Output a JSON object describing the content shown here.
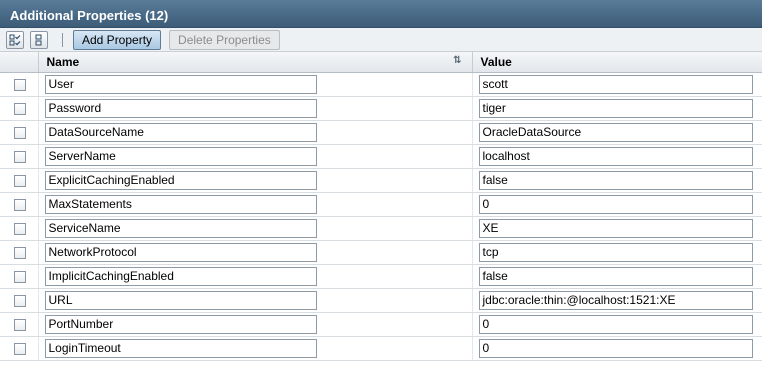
{
  "panel": {
    "title": "Additional Properties (12)"
  },
  "toolbar": {
    "select_all_icon": "select-all-icon",
    "select_none_icon": "select-none-icon",
    "add_label": "Add Property",
    "delete_label": "Delete Properties"
  },
  "table": {
    "headers": {
      "name": "Name",
      "value": "Value"
    },
    "rows": [
      {
        "name": "User",
        "value": "scott"
      },
      {
        "name": "Password",
        "value": "tiger"
      },
      {
        "name": "DataSourceName",
        "value": "OracleDataSource"
      },
      {
        "name": "ServerName",
        "value": "localhost"
      },
      {
        "name": "ExplicitCachingEnabled",
        "value": "false"
      },
      {
        "name": "MaxStatements",
        "value": "0"
      },
      {
        "name": "ServiceName",
        "value": "XE"
      },
      {
        "name": "NetworkProtocol",
        "value": "tcp"
      },
      {
        "name": "ImplicitCachingEnabled",
        "value": "false"
      },
      {
        "name": "URL",
        "value": "jdbc:oracle:thin:@localhost:1521:XE"
      },
      {
        "name": "PortNumber",
        "value": "0"
      },
      {
        "name": "LoginTimeout",
        "value": "0"
      }
    ]
  }
}
